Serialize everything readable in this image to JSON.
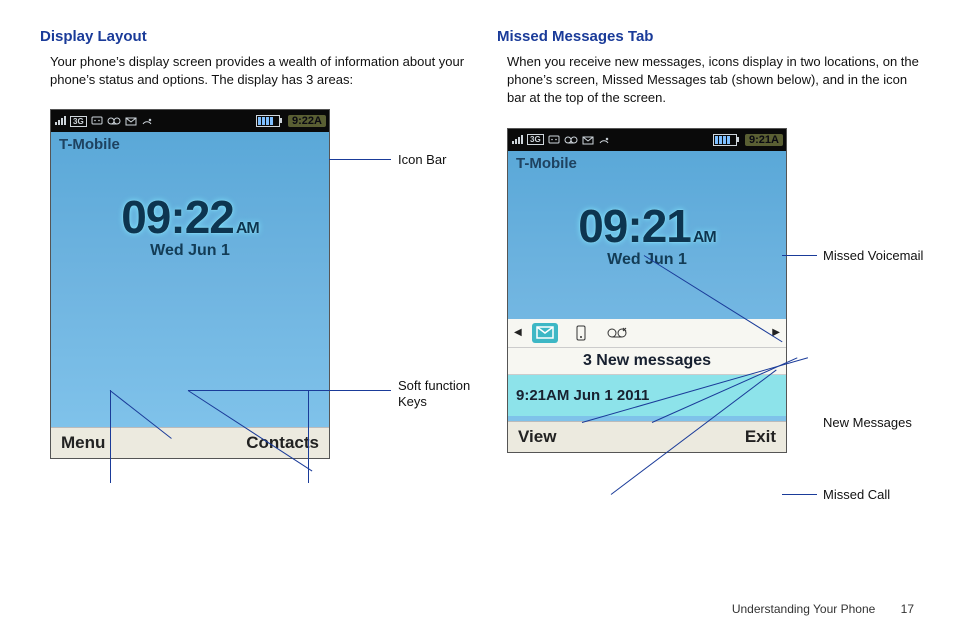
{
  "left": {
    "heading": "Display Layout",
    "intro": "Your phone’s display screen provides a wealth of information about your phone’s status and options. The display has 3 areas:",
    "phone": {
      "carrier": "T-Mobile",
      "clock": "9:22A",
      "time": "09:22",
      "ampm": "AM",
      "date": "Wed Jun 1",
      "soft_left": "Menu",
      "soft_right": "Contacts"
    },
    "callouts": {
      "icon_bar": "Icon Bar",
      "soft_keys": "Soft function Keys"
    }
  },
  "right": {
    "heading": "Missed Messages Tab",
    "intro": "When you receive new messages, icons display in two locations, on the phone’s screen, Missed Messages tab (shown below), and in the icon bar at the top of the screen.",
    "phone": {
      "carrier": "T-Mobile",
      "clock": "9:21A",
      "time": "09:21",
      "ampm": "AM",
      "date": "Wed Jun 1",
      "notif_head": "3 New messages",
      "notif_body": "9:21AM Jun 1 2011",
      "soft_left": "View",
      "soft_right": "Exit"
    },
    "callouts": {
      "missed_voicemail": "Missed Voicemail",
      "new_messages": "New Messages",
      "missed_call": "Missed Call"
    }
  },
  "footer": {
    "section": "Understanding Your Phone",
    "page": "17"
  }
}
